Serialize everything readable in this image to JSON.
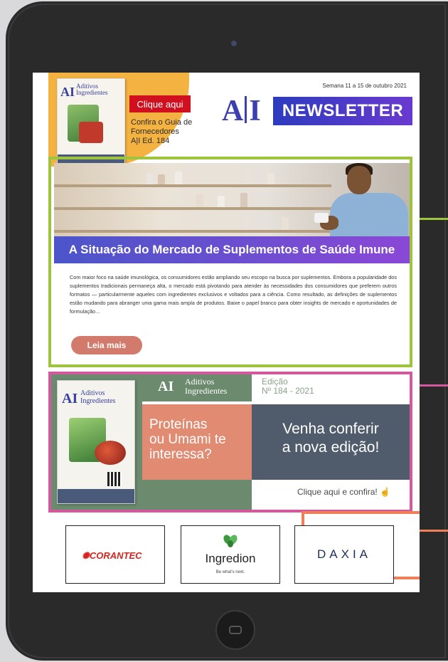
{
  "header": {
    "click_here": "Clique aqui",
    "guide_lines": [
      "Confira o Guia de",
      "Fornecedores",
      "A|I Ed. 184"
    ],
    "week": "Semana 11 a 15 de outubro 2021",
    "logo": "A|I",
    "newsletter_label": "NEWSLETTER",
    "cover_logo": "AI",
    "cover_logo_text": [
      "Aditivos",
      "Ingredientes"
    ]
  },
  "article": {
    "title": "A Situação do Mercado de Suplementos de Saúde Imune",
    "body": "Com maior foco na saúde imunológica, os consumidores estão ampliando seu escopo na busca por suplementos. Embora a popularidade dos suplementos tradicionais permaneça alta, o mercado está pivotando para atender às necessidades dos consumidores que preferem outros formatos — particularmente aqueles com ingredientes exclusivos e voltados para a ciência. Como resultado, as definições de suplementos estão mudando para abranger uma gama mais ampla de produtos. Baixe o papel branco para obter insights de mercado e oportunidades de formulação...",
    "read_more": "Leia mais"
  },
  "edition": {
    "logo": "AI",
    "logo_text": [
      "Aditivos",
      "Ingredientes"
    ],
    "edition_lines": [
      "Edição",
      "Nº 184 - 2021"
    ],
    "question_lines": [
      "Proteínas",
      "ou Umami te",
      "interessa?"
    ],
    "invite_lines": [
      "Venha conferir",
      "a nova edição!"
    ],
    "cta": "Clique aqui e confira!",
    "cover_logo": "AI",
    "cover_logo_text": [
      "Aditivos",
      "Ingredientes"
    ]
  },
  "sponsors": {
    "corantec": "CORANTEC",
    "ingredion": "Ingredion",
    "ingredion_tagline": "Be what's next.",
    "daxia": "DAXIA"
  },
  "colors": {
    "article_frame": "#9ec33c",
    "edition_frame": "#d2599b",
    "daxia_frame": "#ee7f5a",
    "newsletter_bg": "#2d3bbf",
    "click_button": "#d0101f",
    "read_more": "#d27b6c"
  }
}
